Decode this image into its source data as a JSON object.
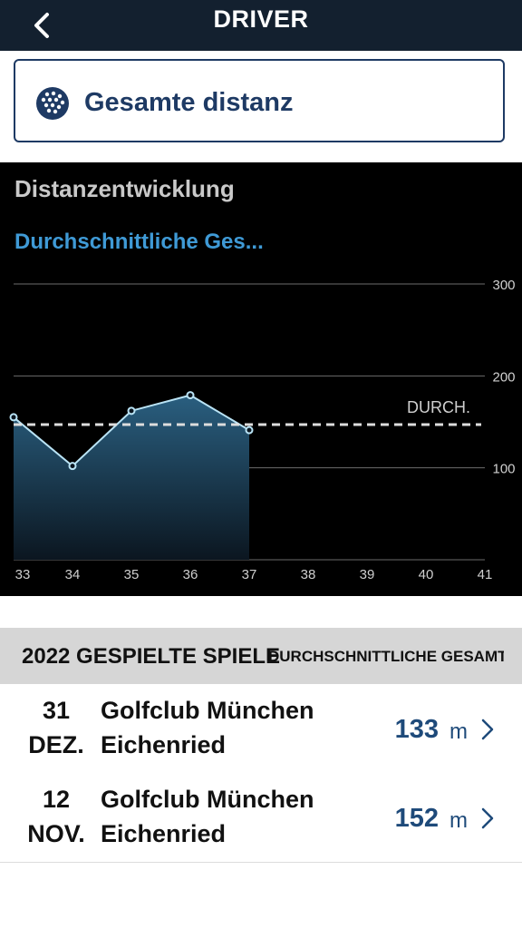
{
  "header": {
    "title": "DRIVER",
    "back_icon": "chevron-left-icon"
  },
  "metric_selector": {
    "label": "Gesamte distanz",
    "icon": "golf-ball-icon"
  },
  "chart_panel": {
    "title": "Distanzentwicklung",
    "subtitle": "Durchschnittliche Ges..."
  },
  "chart_data": {
    "type": "area",
    "x": [
      33,
      34,
      35,
      36,
      37
    ],
    "values": [
      155,
      102,
      162,
      179,
      141
    ],
    "xticks": [
      "33",
      "34",
      "35",
      "36",
      "37",
      "38",
      "39",
      "40",
      "41"
    ],
    "yticks": [
      "100",
      "200",
      "300"
    ],
    "ylim": [
      0,
      300
    ],
    "xlim": [
      33,
      41
    ],
    "average_value": 147,
    "average_label": "DURCH.",
    "grid": true,
    "colors": {
      "line": "#b9e3f5",
      "fill_top": "#2a5f80",
      "fill_bottom": "#0b1620",
      "avg": "#dddddd"
    }
  },
  "games_section": {
    "left_header": "2022 GESPIELTE SPIELE",
    "right_header": "DURCHSCHNITTLICHE GESAMT...",
    "rows": [
      {
        "day": "31",
        "month": "DEZ.",
        "club_line1": "Golfclub München",
        "club_line2": "Eichenried",
        "value": "133",
        "unit": "m"
      },
      {
        "day": "12",
        "month": "NOV.",
        "club_line1": "Golfclub München",
        "club_line2": "Eichenried",
        "value": "152",
        "unit": "m"
      }
    ]
  },
  "colors": {
    "navbar": "#13202f",
    "accent": "#1e3a64",
    "link": "#3f9ad6"
  }
}
